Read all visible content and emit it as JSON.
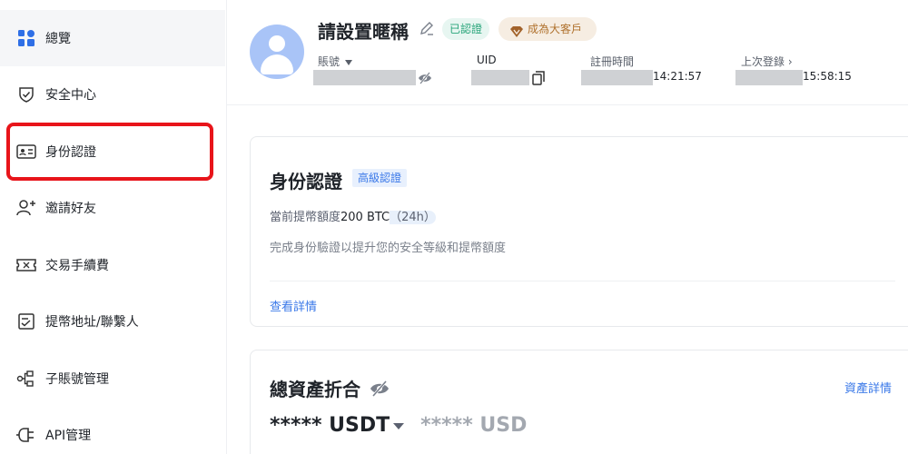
{
  "sidebar": {
    "items": [
      {
        "label": "總覽",
        "icon": "dashboard-icon"
      },
      {
        "label": "安全中心",
        "icon": "shield-icon"
      },
      {
        "label": "身份認證",
        "icon": "id-card-icon"
      },
      {
        "label": "邀請好友",
        "icon": "add-user-icon"
      },
      {
        "label": "交易手續費",
        "icon": "ticket-icon"
      },
      {
        "label": "提幣地址/聯繫人",
        "icon": "address-book-icon"
      },
      {
        "label": "子賬號管理",
        "icon": "sub-account-icon"
      },
      {
        "label": "API管理",
        "icon": "plug-icon"
      }
    ]
  },
  "profile": {
    "nickname": "請設置暱稱",
    "verified_badge": "已認證",
    "vip_badge": "成為大客戶",
    "account_label": "賬號",
    "uid_label": "UID",
    "register_label": "註冊時間",
    "register_time": "14:21:57",
    "last_login_label": "上次登錄 ›",
    "last_login_time": "15:58:15"
  },
  "identity_card": {
    "title": "身份認證",
    "tag": "高級認證",
    "limit_prefix": "當前提幣額度",
    "limit_value": "200 BTC",
    "limit_period": "（24h）",
    "desc": "完成身份驗證以提升您的安全等級和提幣額度",
    "detail_link": "查看詳情"
  },
  "asset_card": {
    "title": "總資產折合",
    "detail_link": "資產詳情",
    "value_primary": "***** USDT",
    "value_secondary": "***** USD"
  },
  "colors": {
    "accent": "#3a78e8",
    "highlight": "#e8141a",
    "verified": "#28a57a",
    "vip": "#b0722e"
  }
}
